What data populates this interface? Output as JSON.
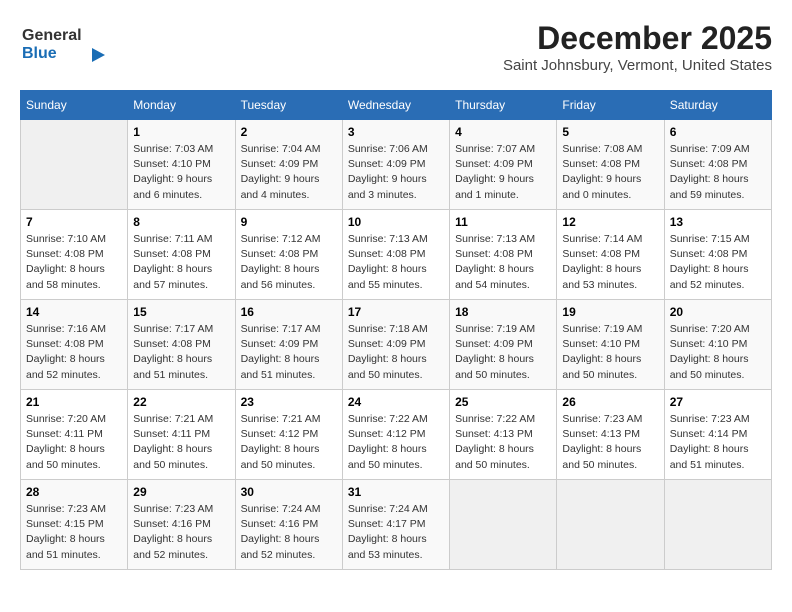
{
  "logo": {
    "line1": "General",
    "line2": "Blue"
  },
  "title": "December 2025",
  "subtitle": "Saint Johnsbury, Vermont, United States",
  "weekdays": [
    "Sunday",
    "Monday",
    "Tuesday",
    "Wednesday",
    "Thursday",
    "Friday",
    "Saturday"
  ],
  "weeks": [
    [
      {
        "num": "",
        "sunrise": "",
        "sunset": "",
        "daylight": ""
      },
      {
        "num": "1",
        "sunrise": "Sunrise: 7:03 AM",
        "sunset": "Sunset: 4:10 PM",
        "daylight": "Daylight: 9 hours and 6 minutes."
      },
      {
        "num": "2",
        "sunrise": "Sunrise: 7:04 AM",
        "sunset": "Sunset: 4:09 PM",
        "daylight": "Daylight: 9 hours and 4 minutes."
      },
      {
        "num": "3",
        "sunrise": "Sunrise: 7:06 AM",
        "sunset": "Sunset: 4:09 PM",
        "daylight": "Daylight: 9 hours and 3 minutes."
      },
      {
        "num": "4",
        "sunrise": "Sunrise: 7:07 AM",
        "sunset": "Sunset: 4:09 PM",
        "daylight": "Daylight: 9 hours and 1 minute."
      },
      {
        "num": "5",
        "sunrise": "Sunrise: 7:08 AM",
        "sunset": "Sunset: 4:08 PM",
        "daylight": "Daylight: 9 hours and 0 minutes."
      },
      {
        "num": "6",
        "sunrise": "Sunrise: 7:09 AM",
        "sunset": "Sunset: 4:08 PM",
        "daylight": "Daylight: 8 hours and 59 minutes."
      }
    ],
    [
      {
        "num": "7",
        "sunrise": "Sunrise: 7:10 AM",
        "sunset": "Sunset: 4:08 PM",
        "daylight": "Daylight: 8 hours and 58 minutes."
      },
      {
        "num": "8",
        "sunrise": "Sunrise: 7:11 AM",
        "sunset": "Sunset: 4:08 PM",
        "daylight": "Daylight: 8 hours and 57 minutes."
      },
      {
        "num": "9",
        "sunrise": "Sunrise: 7:12 AM",
        "sunset": "Sunset: 4:08 PM",
        "daylight": "Daylight: 8 hours and 56 minutes."
      },
      {
        "num": "10",
        "sunrise": "Sunrise: 7:13 AM",
        "sunset": "Sunset: 4:08 PM",
        "daylight": "Daylight: 8 hours and 55 minutes."
      },
      {
        "num": "11",
        "sunrise": "Sunrise: 7:13 AM",
        "sunset": "Sunset: 4:08 PM",
        "daylight": "Daylight: 8 hours and 54 minutes."
      },
      {
        "num": "12",
        "sunrise": "Sunrise: 7:14 AM",
        "sunset": "Sunset: 4:08 PM",
        "daylight": "Daylight: 8 hours and 53 minutes."
      },
      {
        "num": "13",
        "sunrise": "Sunrise: 7:15 AM",
        "sunset": "Sunset: 4:08 PM",
        "daylight": "Daylight: 8 hours and 52 minutes."
      }
    ],
    [
      {
        "num": "14",
        "sunrise": "Sunrise: 7:16 AM",
        "sunset": "Sunset: 4:08 PM",
        "daylight": "Daylight: 8 hours and 52 minutes."
      },
      {
        "num": "15",
        "sunrise": "Sunrise: 7:17 AM",
        "sunset": "Sunset: 4:08 PM",
        "daylight": "Daylight: 8 hours and 51 minutes."
      },
      {
        "num": "16",
        "sunrise": "Sunrise: 7:17 AM",
        "sunset": "Sunset: 4:09 PM",
        "daylight": "Daylight: 8 hours and 51 minutes."
      },
      {
        "num": "17",
        "sunrise": "Sunrise: 7:18 AM",
        "sunset": "Sunset: 4:09 PM",
        "daylight": "Daylight: 8 hours and 50 minutes."
      },
      {
        "num": "18",
        "sunrise": "Sunrise: 7:19 AM",
        "sunset": "Sunset: 4:09 PM",
        "daylight": "Daylight: 8 hours and 50 minutes."
      },
      {
        "num": "19",
        "sunrise": "Sunrise: 7:19 AM",
        "sunset": "Sunset: 4:10 PM",
        "daylight": "Daylight: 8 hours and 50 minutes."
      },
      {
        "num": "20",
        "sunrise": "Sunrise: 7:20 AM",
        "sunset": "Sunset: 4:10 PM",
        "daylight": "Daylight: 8 hours and 50 minutes."
      }
    ],
    [
      {
        "num": "21",
        "sunrise": "Sunrise: 7:20 AM",
        "sunset": "Sunset: 4:11 PM",
        "daylight": "Daylight: 8 hours and 50 minutes."
      },
      {
        "num": "22",
        "sunrise": "Sunrise: 7:21 AM",
        "sunset": "Sunset: 4:11 PM",
        "daylight": "Daylight: 8 hours and 50 minutes."
      },
      {
        "num": "23",
        "sunrise": "Sunrise: 7:21 AM",
        "sunset": "Sunset: 4:12 PM",
        "daylight": "Daylight: 8 hours and 50 minutes."
      },
      {
        "num": "24",
        "sunrise": "Sunrise: 7:22 AM",
        "sunset": "Sunset: 4:12 PM",
        "daylight": "Daylight: 8 hours and 50 minutes."
      },
      {
        "num": "25",
        "sunrise": "Sunrise: 7:22 AM",
        "sunset": "Sunset: 4:13 PM",
        "daylight": "Daylight: 8 hours and 50 minutes."
      },
      {
        "num": "26",
        "sunrise": "Sunrise: 7:23 AM",
        "sunset": "Sunset: 4:13 PM",
        "daylight": "Daylight: 8 hours and 50 minutes."
      },
      {
        "num": "27",
        "sunrise": "Sunrise: 7:23 AM",
        "sunset": "Sunset: 4:14 PM",
        "daylight": "Daylight: 8 hours and 51 minutes."
      }
    ],
    [
      {
        "num": "28",
        "sunrise": "Sunrise: 7:23 AM",
        "sunset": "Sunset: 4:15 PM",
        "daylight": "Daylight: 8 hours and 51 minutes."
      },
      {
        "num": "29",
        "sunrise": "Sunrise: 7:23 AM",
        "sunset": "Sunset: 4:16 PM",
        "daylight": "Daylight: 8 hours and 52 minutes."
      },
      {
        "num": "30",
        "sunrise": "Sunrise: 7:24 AM",
        "sunset": "Sunset: 4:16 PM",
        "daylight": "Daylight: 8 hours and 52 minutes."
      },
      {
        "num": "31",
        "sunrise": "Sunrise: 7:24 AM",
        "sunset": "Sunset: 4:17 PM",
        "daylight": "Daylight: 8 hours and 53 minutes."
      },
      {
        "num": "",
        "sunrise": "",
        "sunset": "",
        "daylight": ""
      },
      {
        "num": "",
        "sunrise": "",
        "sunset": "",
        "daylight": ""
      },
      {
        "num": "",
        "sunrise": "",
        "sunset": "",
        "daylight": ""
      }
    ]
  ]
}
